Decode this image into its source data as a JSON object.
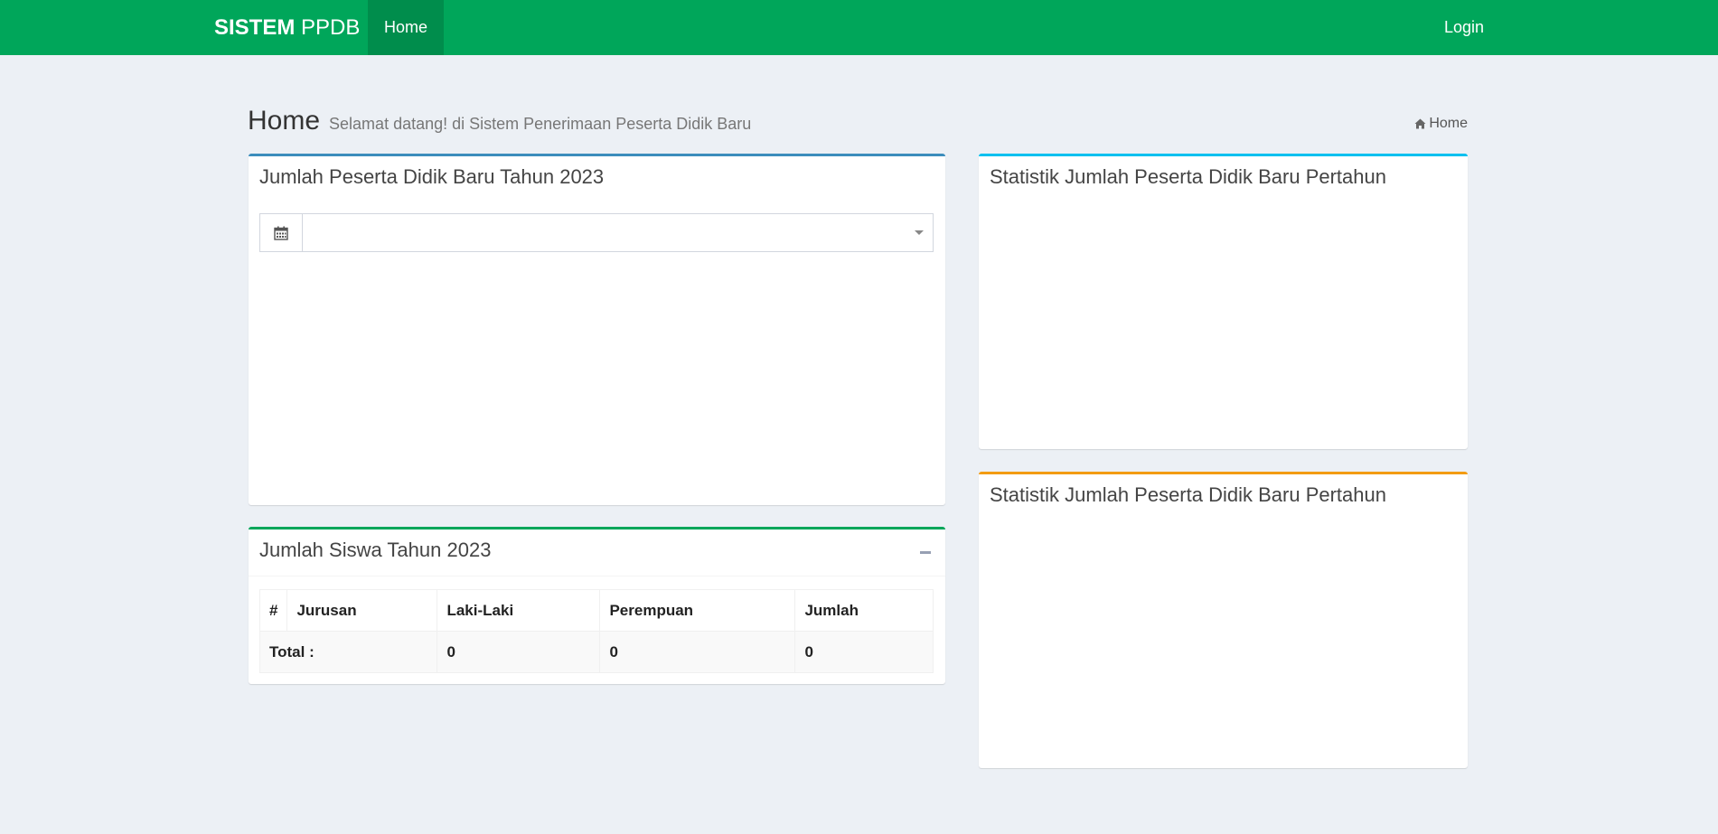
{
  "navbar": {
    "brand_bold": "SISTEM",
    "brand_rest": " PPDB",
    "home": "Home",
    "login": "Login",
    "color": "#00a65a",
    "active_color": "#008d4c"
  },
  "header": {
    "title": "Home",
    "subtitle": "Selamat datang! di Sistem Penerimaan Peserta Didik Baru",
    "breadcrumb": "Home"
  },
  "boxes": {
    "jumlah_peserta": {
      "title": "Jumlah Peserta Didik Baru Tahun 2023",
      "select_value": ""
    },
    "statistik_1": {
      "title": "Statistik Jumlah Peserta Didik Baru Pertahun"
    },
    "statistik_2": {
      "title": "Statistik Jumlah Peserta Didik Baru Pertahun"
    },
    "jumlah_siswa": {
      "title": "Jumlah Siswa Tahun 2023",
      "table": {
        "headers": [
          "#",
          "Jurusan",
          "Laki-Laki",
          "Perempuan",
          "Jumlah"
        ],
        "total_label": "Total :",
        "total_values": [
          "0",
          "0",
          "0"
        ]
      }
    }
  },
  "icons": {
    "breadcrumb": "home-icon",
    "input_addon": "calendar-icon",
    "collapse": "minus-icon"
  }
}
